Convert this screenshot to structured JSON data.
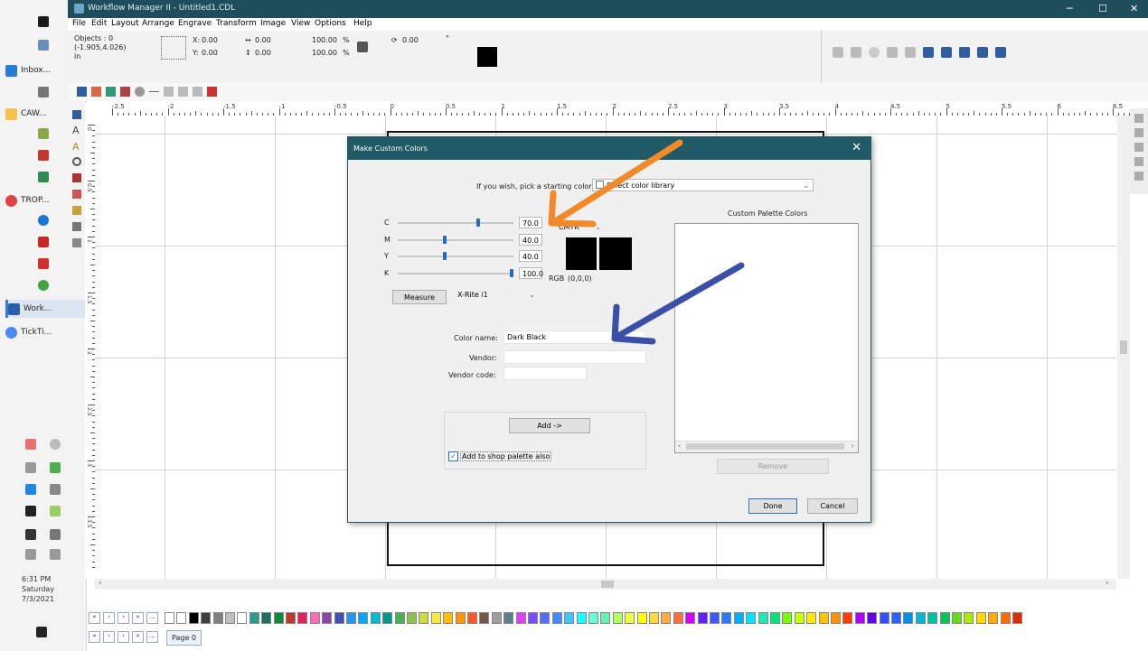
{
  "app": {
    "title": "Workflow Manager II - Untitled1.CDL",
    "menu": [
      "File",
      "Edit",
      "Layout",
      "Arrange",
      "Engrave",
      "Transform",
      "Image",
      "View",
      "Options",
      "Help"
    ]
  },
  "taskbar": {
    "items": [
      {
        "label": "Inbox...",
        "color": "#2b7cd3"
      },
      {
        "label": "CAW...",
        "color": "#f2c14e"
      },
      {
        "label": "TROP...",
        "color": "#d44"
      },
      {
        "label": "Work...",
        "color": "#2b5ea8"
      },
      {
        "label": "TickTi...",
        "color": "#4c8bf5"
      }
    ],
    "time": "6:31 PM",
    "day": "Saturday",
    "date": "7/3/2021"
  },
  "props": {
    "objects_label": "Objects : 0",
    "coords_label": "(-1.905,4.026)",
    "unit": "in",
    "x_label": "X:",
    "x_value": "0.00",
    "y_label": "Y:",
    "y_value": "0.00",
    "w_value": "0.00",
    "h_value": "0.00",
    "scale_x": "100.00",
    "scale_y": "100.00",
    "pct": "%",
    "rotate": "0.00",
    "degree": "°"
  },
  "ruler": {
    "h_ticks": [
      "-2.5",
      "-2",
      "-1.5",
      "-1",
      "-0.5",
      "0",
      "0.5",
      "1",
      "1.5",
      "2",
      "2.5",
      "3",
      "3.5",
      "4",
      "4.5",
      "5",
      "5.5",
      "6",
      "6.5"
    ],
    "v_ticks": [
      "0",
      "0.5",
      "1",
      "1.5",
      "2",
      "2.5",
      "3",
      "3.5"
    ]
  },
  "pagebar": {
    "page_label": "Page 0"
  },
  "dialog": {
    "title": "Make Custom Colors",
    "start_prompt": "If you wish, pick a starting color:",
    "library": "Select color library",
    "channels": [
      {
        "label": "C",
        "value": "70.0",
        "level": 0.7
      },
      {
        "label": "M",
        "value": "40.0",
        "level": 0.4
      },
      {
        "label": "Y",
        "value": "40.0",
        "level": 0.4
      },
      {
        "label": "K",
        "value": "100.0",
        "level": 1.0
      }
    ],
    "mode": "CMYK",
    "rgb_label": "RGB",
    "rgb_value": "(0,0,0)",
    "measure_button": "Measure",
    "device": "X-Rite i1",
    "custom_palette_title": "Custom Palette Colors",
    "color_name_label": "Color name:",
    "color_name_value": "Dark Black",
    "vendor_label": "Vendor:",
    "vendor_value": "",
    "vendor_code_label": "Vendor code:",
    "vendor_code_value": "",
    "add_button": "Add ->",
    "add_to_shop_label": "Add to shop palette also",
    "remove_button": "Remove",
    "done_button": "Done",
    "cancel_button": "Cancel"
  },
  "annotations": {
    "orange_arrow_color": "#f28a2a",
    "blue_arrow_color": "#3b4fa8"
  },
  "palette_colors": [
    "#ffffff",
    "#ffffff",
    "#000000",
    "#404040",
    "#808080",
    "#c0c0c0",
    "#ffffff",
    "#2a9d8f",
    "#1e6f5c",
    "#0d8a3a",
    "#c0392b",
    "#e91e63",
    "#ff69b4",
    "#8e44ad",
    "#3f51b5",
    "#2196f3",
    "#03a9f4",
    "#00bcd4",
    "#009688",
    "#4caf50",
    "#8bc34a",
    "#cddc39",
    "#ffeb3b",
    "#ffc107",
    "#ff9800",
    "#ff5722",
    "#795548",
    "#9e9e9e",
    "#607d8b",
    "#e040fb",
    "#7c4dff",
    "#536dfe",
    "#448aff",
    "#40c4ff",
    "#18ffff",
    "#64ffda",
    "#69f0ae",
    "#b2ff59",
    "#eeff41",
    "#ffff00",
    "#ffd740",
    "#ffab40",
    "#ff6e40",
    "#d500f9",
    "#651fff",
    "#3d5afe",
    "#2979ff",
    "#00b0ff",
    "#00e5ff",
    "#1de9b6",
    "#00e676",
    "#76ff03",
    "#c6ff00",
    "#ffea00",
    "#ffc400",
    "#ff9100",
    "#ff3d00",
    "#aa00ff",
    "#6200ea",
    "#304ffe",
    "#2962ff",
    "#0091ea",
    "#00b8d4",
    "#00bfa5",
    "#00c853",
    "#64dd17",
    "#aeea00",
    "#ffd600",
    "#ffab00",
    "#ff6d00",
    "#dd2c00"
  ]
}
